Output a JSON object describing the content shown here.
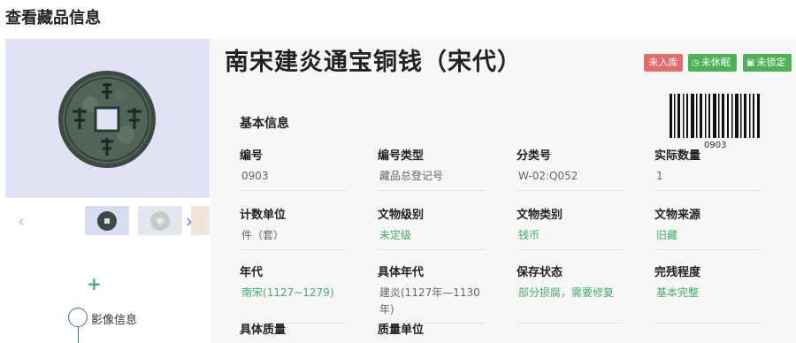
{
  "page": {
    "title": "查看藏品信息"
  },
  "object": {
    "title": "南宋建炎通宝铜钱（宋代）",
    "badges": [
      {
        "label": "未入库",
        "color": "#e46b6b",
        "icon": ""
      },
      {
        "label": "未休眠",
        "color": "#4db156",
        "icon": "clock-icon"
      },
      {
        "label": "未锁定",
        "color": "#4db156",
        "icon": "lock-icon"
      }
    ]
  },
  "barcode": {
    "text": "0903"
  },
  "basic_info": {
    "section_title": "基本信息",
    "fields": [
      {
        "label": "编号",
        "value": "0903",
        "tone": "plain"
      },
      {
        "label": "编号类型",
        "value": "藏品总登记号",
        "tone": "plain"
      },
      {
        "label": "分类号",
        "value": "W-02:Q052",
        "tone": "plain"
      },
      {
        "label": "实际数量",
        "value": "1",
        "tone": "plain"
      },
      {
        "label": "计数单位",
        "value": "件（套）",
        "tone": "plain"
      },
      {
        "label": "文物级别",
        "value": "未定级",
        "tone": "green"
      },
      {
        "label": "文物类别",
        "value": "钱币",
        "tone": "green"
      },
      {
        "label": "文物来源",
        "value": "旧藏",
        "tone": "green"
      },
      {
        "label": "年代",
        "value": "南宋(1127~1279)",
        "tone": "green"
      },
      {
        "label": "具体年代",
        "value": "建炎(1127年—1130年)",
        "tone": "plain"
      },
      {
        "label": "保存状态",
        "value": "部分损腐，需要修复",
        "tone": "green"
      },
      {
        "label": "完残程度",
        "value": "基本完整",
        "tone": "green"
      },
      {
        "label": "具体质量",
        "value": "",
        "tone": "plain"
      },
      {
        "label": "质量单位",
        "value": "",
        "tone": "plain"
      }
    ]
  },
  "gallery": {
    "prev_icon": "chevron-left-icon",
    "next_icon": "chevron-right-icon"
  },
  "sidebar": {
    "add_icon": "plus-icon",
    "media_label": "影像信息"
  },
  "colors": {
    "accent_green": "#3fae6a",
    "badge_red": "#e46b6b",
    "badge_green": "#4db156",
    "link_blue": "#4a7bd8"
  }
}
